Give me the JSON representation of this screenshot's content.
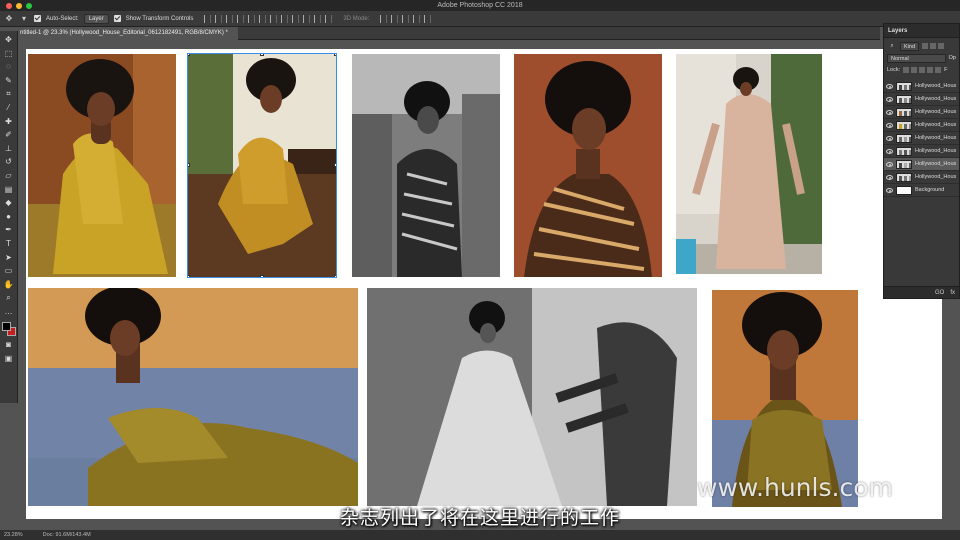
{
  "window": {
    "title": "Adobe Photoshop CC 2018"
  },
  "options_bar": {
    "auto_select_label": "Auto-Select:",
    "auto_select_value": "Layer",
    "transform_controls_label": "Show Transform Controls",
    "mode_3d_label": "3D Mode:"
  },
  "document_tab": {
    "label": "ntitled-1 @ 23.3% (Hollywood_House_Editorial_0612182491, RGB/8/CMYK) *"
  },
  "layers_panel": {
    "title": "Layers",
    "filter_kind": "Kind",
    "blend_mode": "Normal",
    "opacity_label": "Op",
    "lock_label": "Lock:",
    "fill_label": "F",
    "layers": [
      {
        "name": "Hollywood_Hous"
      },
      {
        "name": "Hollywood_Hous"
      },
      {
        "name": "Hollywood_Hous"
      },
      {
        "name": "Hollywood_Hous"
      },
      {
        "name": "Hollywood_Hous"
      },
      {
        "name": "Hollywood_Hous"
      },
      {
        "name": "Hollywood_Hous"
      },
      {
        "name": "Hollywood_Hous"
      },
      {
        "name": "Background"
      }
    ],
    "footer_link": "GO",
    "footer_fx": "fx"
  },
  "status_bar": {
    "zoom": "23.28%",
    "doc_info": "Doc: 91.6M/143.4M"
  },
  "subtitle": "杂志列出了将在这里进行的工作",
  "watermark": "www.hunls.com",
  "colors": {
    "foreground": "#000000",
    "background": "#c41e1e",
    "accent": "#3a8ee6"
  }
}
